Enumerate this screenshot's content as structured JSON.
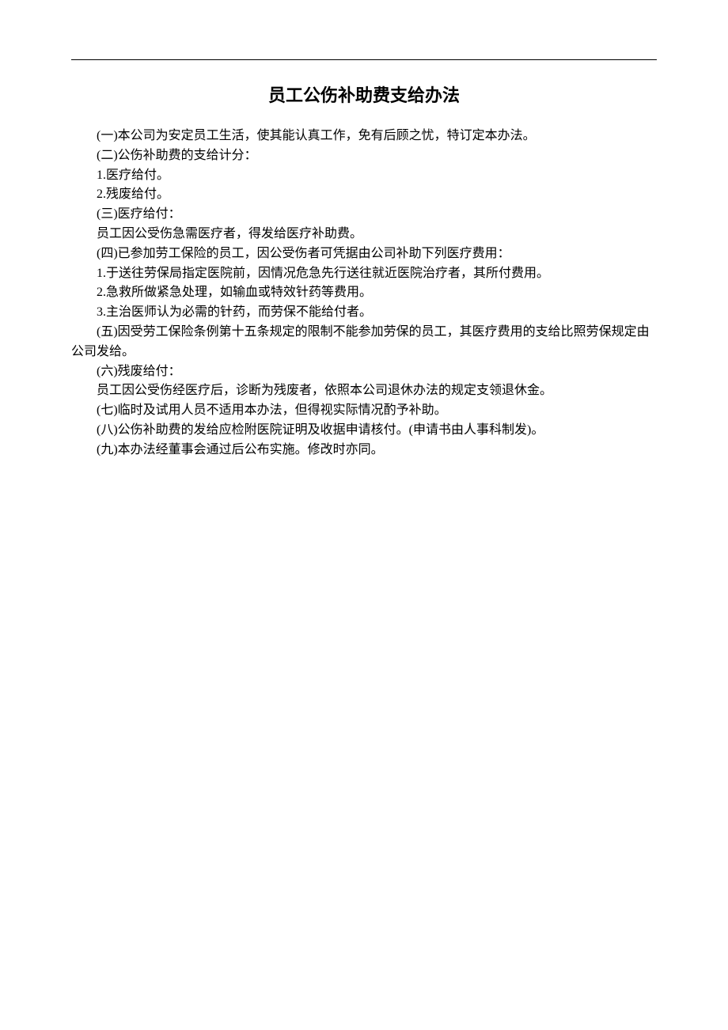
{
  "document": {
    "title": "员工公伤补助费支给办法",
    "paragraphs": [
      {
        "text": "(一)本公司为安定员工生活，使其能认真工作，免有后顾之忧，特订定本办法。",
        "indent": true
      },
      {
        "text": "(二)公伤补助费的支给计分：",
        "indent": true
      },
      {
        "text": "1.医疗给付。",
        "indent": true
      },
      {
        "text": "2.残废给付。",
        "indent": true
      },
      {
        "text": "(三)医疗给付：",
        "indent": true
      },
      {
        "text": "员工因公受伤急需医疗者，得发给医疗补助费。",
        "indent": true
      },
      {
        "text": "(四)已参加劳工保险的员工，因公受伤者可凭据由公司补助下列医疗费用：",
        "indent": true
      },
      {
        "text": "1.于送往劳保局指定医院前，因情况危急先行送往就近医院治疗者，其所付费用。",
        "indent": true
      },
      {
        "text": "2.急救所做紧急处理，如输血或特效针药等费用。",
        "indent": true
      },
      {
        "text": "3.主治医师认为必需的针药，而劳保不能给付者。",
        "indent": true
      },
      {
        "text": "(五)因受劳工保险条例第十五条规定的限制不能参加劳保的员工，其医疗费用的支给比照劳保规定由公司发给。",
        "indent": true
      },
      {
        "text": "(六)残废给付：",
        "indent": true
      },
      {
        "text": "员工因公受伤经医疗后，诊断为残废者，依照本公司退休办法的规定支领退休金。",
        "indent": true
      },
      {
        "text": "(七)临时及试用人员不适用本办法，但得视实际情况酌予补助。",
        "indent": true
      },
      {
        "text": "(八)公伤补助费的发给应检附医院证明及收据申请核付。(申请书由人事科制发)。",
        "indent": true
      },
      {
        "text": "(九)本办法经董事会通过后公布实施。修改时亦同。",
        "indent": true
      }
    ]
  }
}
